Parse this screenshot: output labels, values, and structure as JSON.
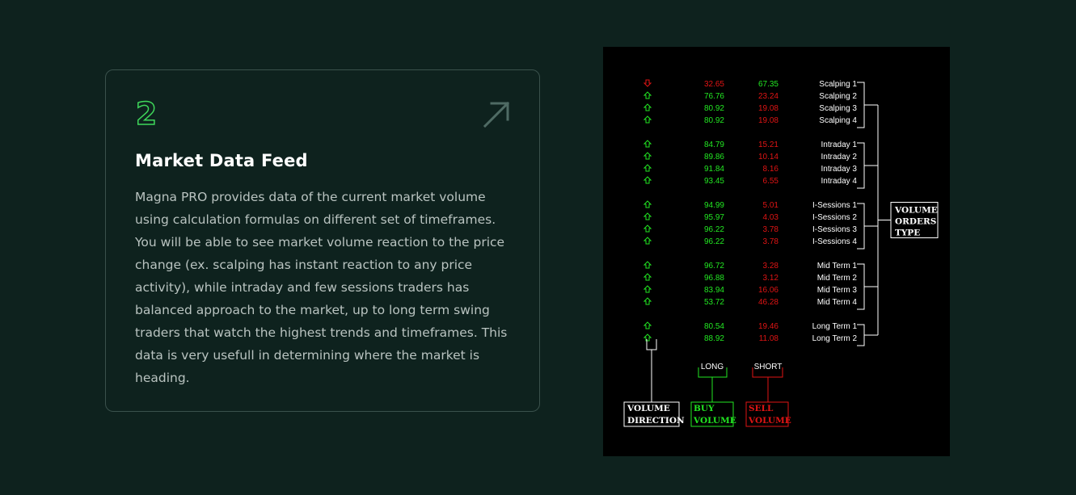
{
  "card": {
    "number": "2",
    "title": "Market Data Feed",
    "description": "Magna PRO provides data of the current market volume using calculation formulas on different set of timeframes. You will be able to see market volume reaction to the price change (ex. scalping has instant reaction to any price activity), while intraday and few sessions traders has balanced approach to the market, up to long term swing traders that watch the highest trends and timeframes. This data is very usefull in determining where the market is heading."
  },
  "colors": {
    "background": "#0e221e",
    "accent_green": "#3ed65a",
    "panel": "#000000",
    "buy": "#22e622",
    "sell": "#e01414"
  },
  "table": {
    "groups": [
      {
        "rows": [
          {
            "dir": "down",
            "buy": "32.65",
            "sell": "67.35",
            "label": "Scalping 1"
          },
          {
            "dir": "up",
            "buy": "76.76",
            "sell": "23.24",
            "label": "Scalping 2"
          },
          {
            "dir": "up",
            "buy": "80.92",
            "sell": "19.08",
            "label": "Scalping 3"
          },
          {
            "dir": "up",
            "buy": "80.92",
            "sell": "19.08",
            "label": "Scalping 4"
          }
        ]
      },
      {
        "rows": [
          {
            "dir": "up",
            "buy": "84.79",
            "sell": "15.21",
            "label": "Intraday 1"
          },
          {
            "dir": "up",
            "buy": "89.86",
            "sell": "10.14",
            "label": "Intraday 2"
          },
          {
            "dir": "up",
            "buy": "91.84",
            "sell": "8.16",
            "label": "Intraday 3"
          },
          {
            "dir": "up",
            "buy": "93.45",
            "sell": "6.55",
            "label": "Intraday 4"
          }
        ]
      },
      {
        "rows": [
          {
            "dir": "up",
            "buy": "94.99",
            "sell": "5.01",
            "label": "I-Sessions 1"
          },
          {
            "dir": "up",
            "buy": "95.97",
            "sell": "4.03",
            "label": "I-Sessions 2"
          },
          {
            "dir": "up",
            "buy": "96.22",
            "sell": "3.78",
            "label": "I-Sessions 3"
          },
          {
            "dir": "up",
            "buy": "96.22",
            "sell": "3.78",
            "label": "I-Sessions 4"
          }
        ]
      },
      {
        "rows": [
          {
            "dir": "up",
            "buy": "96.72",
            "sell": "3.28",
            "label": "Mid Term 1"
          },
          {
            "dir": "up",
            "buy": "96.88",
            "sell": "3.12",
            "label": "Mid Term 2"
          },
          {
            "dir": "up",
            "buy": "83.94",
            "sell": "16.06",
            "label": "Mid Term 3"
          },
          {
            "dir": "up",
            "buy": "53.72",
            "sell": "46.28",
            "label": "Mid Term 4"
          }
        ]
      },
      {
        "rows": [
          {
            "dir": "up",
            "buy": "80.54",
            "sell": "19.46",
            "label": "Long Term 1"
          },
          {
            "dir": "up",
            "buy": "88.92",
            "sell": "11.08",
            "label": "Long Term 2"
          }
        ]
      }
    ],
    "labels": {
      "long": "LONG",
      "short": "SHORT",
      "volume_direction": [
        "VOLUME",
        "DIRECTION"
      ],
      "buy_volume": [
        "BUY",
        "VOLUME"
      ],
      "sell_volume": [
        "SELL",
        "VOLUME"
      ],
      "volume_orders_type": [
        "VOLUME",
        "ORDERS",
        "TYPE"
      ]
    }
  }
}
